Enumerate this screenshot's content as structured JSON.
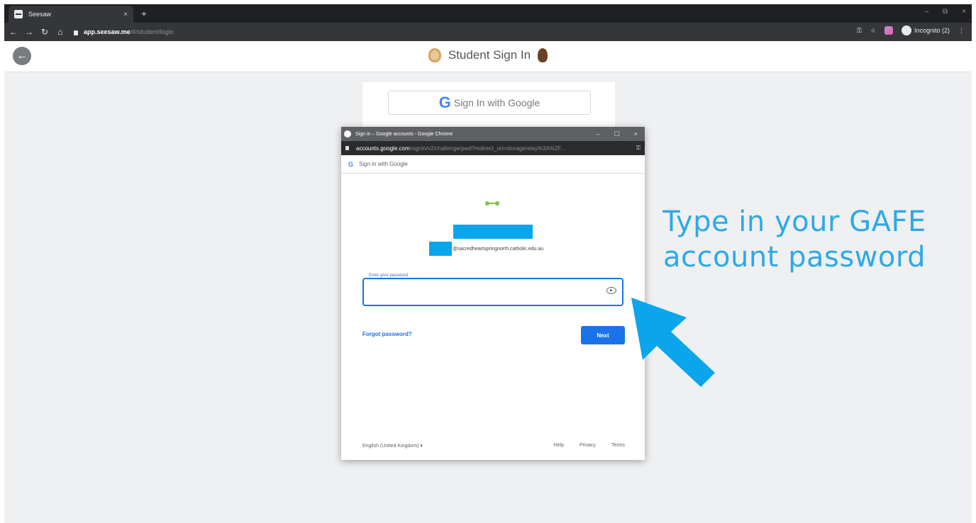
{
  "browser": {
    "tab_title": "Seesaw",
    "tab_close": "×",
    "new_tab": "+",
    "window_controls": [
      "–",
      "⧉",
      "×"
    ],
    "url_host": "app.seesaw.me",
    "url_path": "/#/student/login",
    "profile_label": "Incognito (2)"
  },
  "page": {
    "header_title": "Student Sign In",
    "back_icon": "back-arrow-icon",
    "google_button": "Sign In with Google",
    "google_logo": "G"
  },
  "popup": {
    "window_title": "Sign in – Google accounts - Google Chrome",
    "window_controls": [
      "–",
      "☐",
      "×"
    ],
    "url_host": "accounts.google.com",
    "url_path": "/signin/v2/challenge/pwd?redirect_uri=storagerelay%3A%2F...",
    "header_g": "G",
    "header_text": "Sign in with Google",
    "email_suffix": "@sacredheartspringnorth.catholic.edu.au",
    "password_label": "Enter your password",
    "password_value": "",
    "forgot_link": "Forgot password?",
    "next_button": "Next",
    "language": "English (United Kingdom)",
    "language_caret": "▾",
    "footer_links": [
      "Help",
      "Privacy",
      "Terms"
    ]
  },
  "annotation": {
    "line1": "Type in your GAFE",
    "line2": "account password",
    "color": "#2ea9e6"
  }
}
